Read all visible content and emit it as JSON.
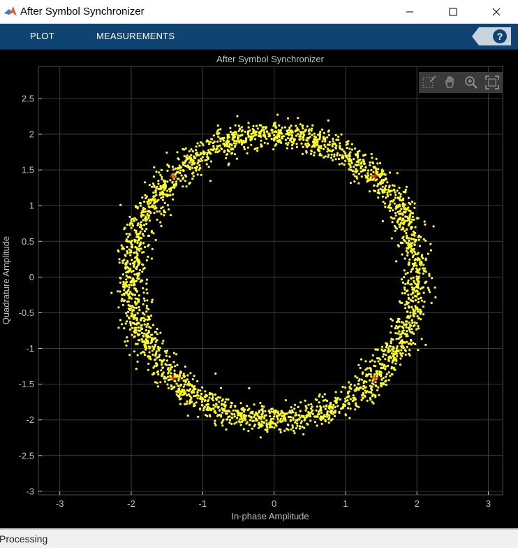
{
  "window": {
    "title": "After Symbol Synchronizer"
  },
  "toolstrip": {
    "tabs": [
      "PLOT",
      "MEASUREMENTS"
    ],
    "help_label": "?"
  },
  "axes_toolbar": {
    "buttons": [
      "data-tips-icon",
      "pan-icon",
      "zoom-in-icon",
      "restore-view-icon"
    ]
  },
  "colors": {
    "samples": "#ffff1a",
    "reference": "#ff2a00",
    "background": "#000000",
    "grid": "#3a3a3a",
    "toolstrip": "#0e4372"
  },
  "chart_data": {
    "type": "scatter",
    "title": "After Symbol Synchronizer",
    "xlabel": "In-phase Amplitude",
    "ylabel": "Quadrature Amplitude",
    "xlim": [
      -3.3,
      3.2
    ],
    "ylim": [
      -3.05,
      2.95
    ],
    "xticks": [
      -3,
      -2,
      -1,
      0,
      1,
      2,
      3
    ],
    "yticks": [
      -3,
      -2.5,
      -2,
      -1.5,
      -1,
      -0.5,
      0,
      0.5,
      1,
      1.5,
      2,
      2.5
    ],
    "ytick_labels": [
      "-3",
      "-2.5",
      "-2",
      "-1.5",
      "-1",
      "-0.5",
      "0",
      "0.5",
      "1",
      "1.5",
      "2",
      "2.5"
    ],
    "grid": true,
    "series": [
      {
        "description": "received symbols (ring)",
        "distribution": {
          "radius_mean": 2.0,
          "radius_std": 0.1,
          "count": 3000
        }
      }
    ],
    "reference_points": [
      [
        1.414,
        1.414
      ],
      [
        -1.414,
        1.414
      ],
      [
        -1.414,
        -1.414
      ],
      [
        1.414,
        -1.414
      ]
    ]
  },
  "status": {
    "text": "Processing"
  }
}
